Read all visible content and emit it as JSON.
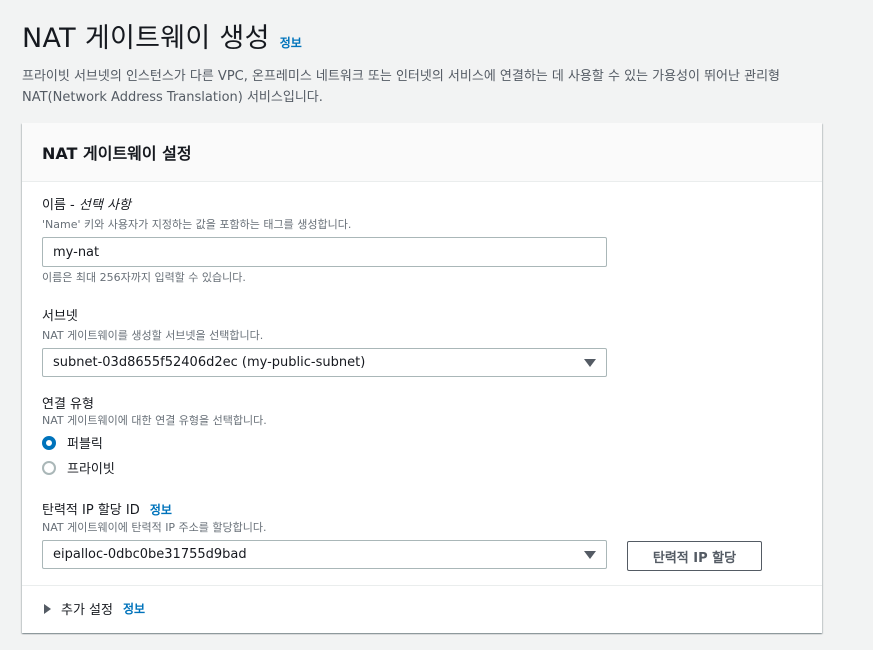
{
  "header": {
    "title": "NAT 게이트웨이 생성",
    "info_link": "정보",
    "description": "프라이빗 서브넷의 인스턴스가 다른 VPC, 온프레미스 네트워크 또는 인터넷의 서비스에 연결하는 데 사용할 수 있는 가용성이 뛰어난 관리형 NAT(Network Address Translation) 서비스입니다."
  },
  "panel": {
    "title": "NAT 게이트웨이 설정",
    "name_field": {
      "label": "이름 - ",
      "label_optional": "선택 사항",
      "description": "'Name' 키와 사용자가 지정하는 값을 포함하는 태그를 생성합니다.",
      "value": "my-nat",
      "constraint": "이름은 최대 256자까지 입력할 수 있습니다."
    },
    "subnet_field": {
      "label": "서브넷",
      "description": "NAT 게이트웨이를 생성할 서브넷을 선택합니다.",
      "selected": "subnet-03d8655f52406d2ec (my-public-subnet)"
    },
    "connectivity_field": {
      "label": "연결 유형",
      "description": "NAT 게이트웨이에 대한 연결 유형을 선택합니다.",
      "options": [
        "퍼블릭",
        "프라이빗"
      ],
      "selected_index": 0
    },
    "eip_field": {
      "label": "탄력적 IP 할당 ID",
      "info_link": "정보",
      "description": "NAT 게이트웨이에 탄력적 IP 주소를 할당합니다.",
      "selected": "eipalloc-0dbc0be31755d9bad",
      "allocate_button": "탄력적 IP 할당"
    },
    "additional": {
      "label": "추가 설정",
      "info_link": "정보"
    }
  },
  "colors": {
    "link": "#0073bb",
    "background": "#f2f3f3",
    "radio_selected": "#0073bb"
  },
  "icons": {
    "dropdown": "caret-down-icon",
    "expander": "caret-right-icon"
  }
}
